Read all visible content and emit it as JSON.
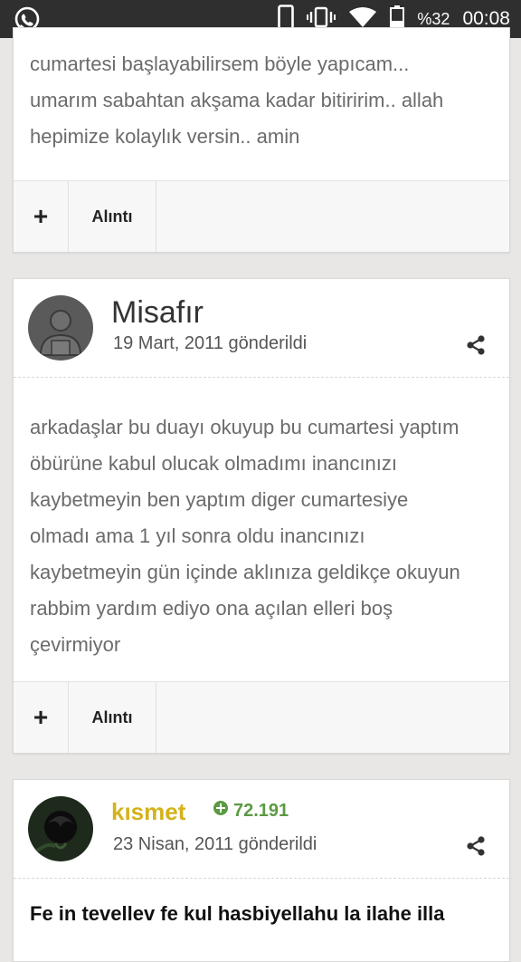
{
  "status_bar": {
    "battery_percent": "%32",
    "time": "00:08"
  },
  "posts": [
    {
      "text": "cumartesi başlayabilirsem böyle yapıcam... umarım sabahtan akşama kadar bitiririm.. allah hepimize kolaylık versin.. amin",
      "actions": {
        "plus": "+",
        "quote": "Alıntı"
      }
    },
    {
      "author": "Misafır",
      "date": "19 Mart, 2011 gönderildi",
      "text": "arkadaşlar bu duayı okuyup bu cumartesi yaptım öbürüne kabul olucak olmadımı inancınızı kaybetmeyin ben yaptım diger cumartesiye olmadı ama 1 yıl sonra oldu inancınızı kaybetmeyin gün içinde aklınıza geldikçe okuyun rabbim yardım ediyo ona açılan elleri boş çevirmiyor",
      "actions": {
        "plus": "+",
        "quote": "Alıntı"
      }
    },
    {
      "author": "kısmet",
      "reputation": "72.191",
      "date": "23 Nisan, 2011 gönderildi",
      "text": "Fe in tevellev fe kul hasbiyellahu la ilahe illa"
    }
  ],
  "icons": {
    "whatsapp": "whatsapp-icon",
    "phone": "phone-icon",
    "vibrate": "vibrate-icon",
    "wifi": "wifi-icon",
    "battery": "battery-icon",
    "share": "share-icon",
    "reputation": "plus-circle-icon"
  },
  "colors": {
    "status_bar": "#2f2f2f",
    "background": "#e9e7e5",
    "username_gold": "#d4b21c",
    "reputation_green": "#5b9a43"
  }
}
